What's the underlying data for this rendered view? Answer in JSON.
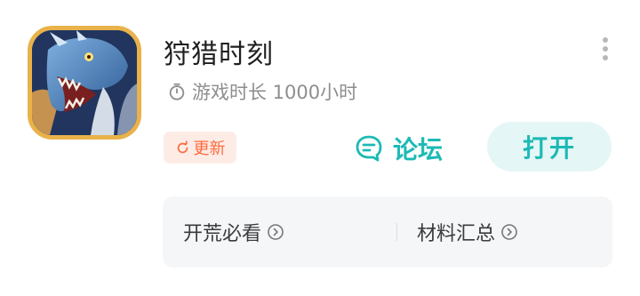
{
  "app": {
    "title": "狩猎时刻",
    "playtime": "游戏时长 1000小时",
    "update_badge": "更新"
  },
  "actions": {
    "forum_label": "论坛",
    "open_label": "打开"
  },
  "quick_links": [
    {
      "label": "开荒必看"
    },
    {
      "label": "材料汇总"
    }
  ],
  "colors": {
    "accent": "#1dbab5",
    "accent_bg": "#e5f6f6",
    "badge_text": "#ff6a3d",
    "badge_bg": "#fdece6",
    "panel_bg": "#f5f6f8",
    "icon_border": "#e9b24a"
  },
  "icons": {
    "app": "dragon-game-icon",
    "more": "more-vertical-icon",
    "playtime": "timer-icon",
    "update": "refresh-icon",
    "forum": "chat-bubble-icon",
    "link": "chevron-right-circle-icon"
  }
}
